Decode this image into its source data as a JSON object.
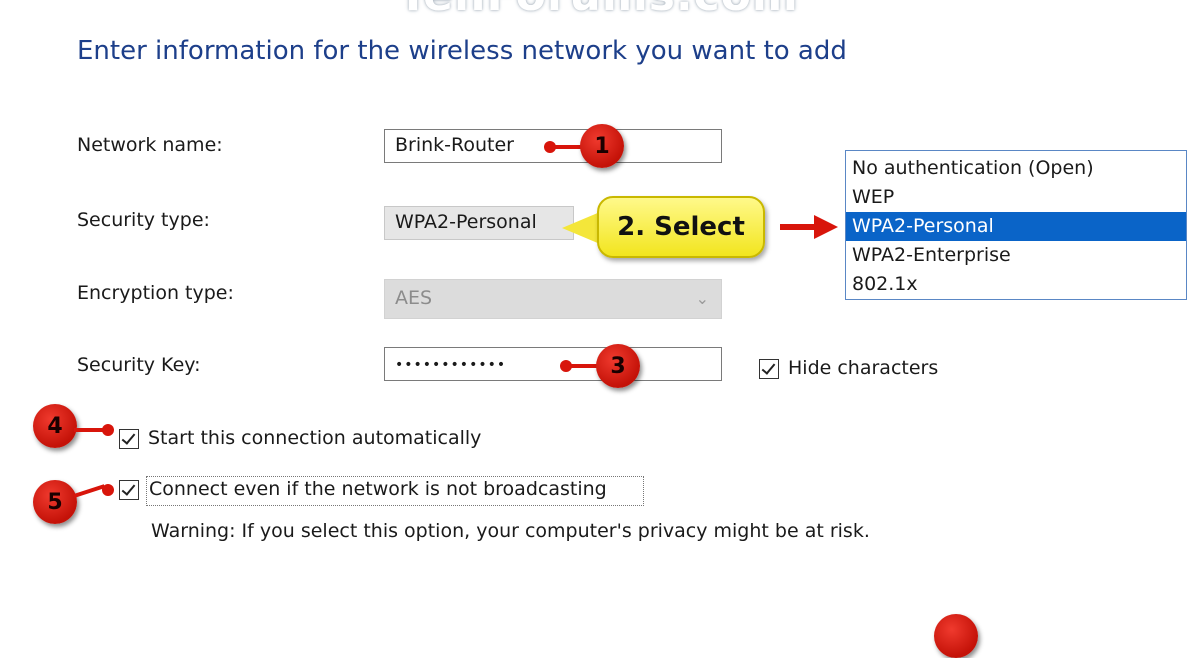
{
  "watermark": "TenForums.com",
  "heading": "Enter information for the wireless network you want to add",
  "form": {
    "network_name": {
      "label": "Network name:",
      "value": "Brink-Router"
    },
    "security_type": {
      "label": "Security type:",
      "value": "WPA2-Personal"
    },
    "encryption_type": {
      "label": "Encryption type:",
      "value": "AES"
    },
    "security_key": {
      "label": "Security Key:",
      "value": "••••••••••••"
    },
    "hide_characters": {
      "label": "Hide characters",
      "checked": true
    },
    "start_auto": {
      "label": "Start this connection automatically",
      "checked": true
    },
    "connect_not_broadcasting": {
      "label": "Connect even if the network is not broadcasting",
      "checked": true
    },
    "warning": "Warning: If you select this option, your computer's privacy might be at risk."
  },
  "security_dropdown": {
    "options": [
      "No authentication (Open)",
      "WEP",
      "WPA2-Personal",
      "WPA2-Enterprise",
      "802.1x"
    ],
    "selected": "WPA2-Personal"
  },
  "annotations": {
    "badge_1": "1",
    "callout_2": "2. Select",
    "badge_3": "3",
    "badge_4": "4",
    "badge_5": "5"
  },
  "colors": {
    "heading": "#1d3f8a",
    "selection": "#0a64c8",
    "badge": "#d8150b",
    "callout": "#f2e51e"
  }
}
